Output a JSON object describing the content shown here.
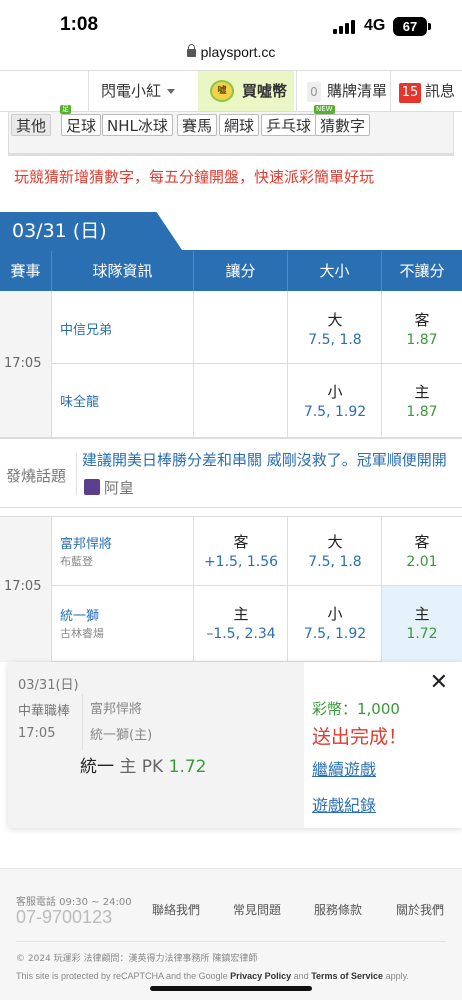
{
  "status_bar": {
    "time": "1:08",
    "network": "4G",
    "battery": "67"
  },
  "browser": {
    "url": "playsport.cc"
  },
  "nav": {
    "user": "閃電小紅",
    "coin_label": "買噓幣",
    "coin_icon_text": "噓",
    "cart_count": "0",
    "cart_label": "購牌清單",
    "msg_count": "15",
    "msg_label": "訊息"
  },
  "categories": [
    {
      "label": "其他",
      "tag": ""
    },
    {
      "label": "足球",
      "tag": "足"
    },
    {
      "label": "NHL冰球",
      "tag": ""
    },
    {
      "label": "賽馬",
      "tag": ""
    },
    {
      "label": "網球",
      "tag": ""
    },
    {
      "label": "乒乓球",
      "tag": ""
    },
    {
      "label": "猜數字",
      "tag": "NEW"
    }
  ],
  "notice": "玩競猜新增猜數字，每五分鐘開盤，快速派彩簡單好玩",
  "date_tab": "03/31 (日)",
  "table_header": {
    "league": "賽事",
    "teams": "球隊資訊",
    "handicap": "讓分",
    "total": "大小",
    "moneyline": "不讓分"
  },
  "games": [
    {
      "time": "17:05",
      "away": {
        "team": "中信兄弟",
        "pitcher": "",
        "handicap_label": "",
        "handicap_val": "",
        "total_label": "大",
        "total_val": "7.5, 1.8",
        "ml_label": "客",
        "ml_val": "1.87"
      },
      "home": {
        "team": "味全龍",
        "pitcher": "",
        "handicap_label": "",
        "handicap_val": "",
        "total_label": "小",
        "total_val": "7.5, 1.92",
        "ml_label": "主",
        "ml_val": "1.87"
      }
    },
    {
      "time": "17:05",
      "away": {
        "team": "富邦悍將",
        "pitcher": "布藍登",
        "handicap_label": "客",
        "handicap_val": "+1.5, 1.56",
        "total_label": "大",
        "total_val": "7.5, 1.8",
        "ml_label": "客",
        "ml_val": "2.01"
      },
      "home": {
        "team": "統一獅",
        "pitcher": "古林睿煬",
        "handicap_label": "主",
        "handicap_val": "–1.5, 2.34",
        "total_label": "小",
        "total_val": "7.5, 1.92",
        "ml_label": "主",
        "ml_val": "1.72"
      }
    }
  ],
  "hot_topic": {
    "label": "發燒話題",
    "title": "建議開美日棒勝分差和串關 威剛沒救了。冠軍順便開開",
    "author": "阿皇"
  },
  "popup": {
    "date": "03/31(日)",
    "league": "中華職棒",
    "time": "17:05",
    "team1": "富邦悍將",
    "team2": "統一獅(主)",
    "pick_team": "統一",
    "pick_side": "主 PK",
    "pick_odd": "1.72",
    "coins": "彩幣：1,000",
    "done": "送出完成！",
    "continue": "繼續遊戲",
    "history": "遊戲紀錄",
    "close": "✕"
  },
  "footer": {
    "phone_label": "客服電話 09:30 ~ 24:00",
    "phone": "07-9700123",
    "links": [
      "聯絡我們",
      "常見問題",
      "服務條款",
      "關於我們"
    ],
    "copyright": "© 2024 玩運彩  法律顧問：漢英得力法律事務所 陳鎮宏律師",
    "captcha_pre": "This site is protected by reCAPTCHA and the Google ",
    "privacy": "Privacy Policy",
    "captcha_and": " and ",
    "terms": "Terms of Service",
    "captcha_post": " apply."
  },
  "colors": {
    "brand_blue": "#2b6fb3",
    "odds_green": "#3a9a3a",
    "alert_red": "#e03c31",
    "highlight_cell": "#e6f2fb"
  }
}
